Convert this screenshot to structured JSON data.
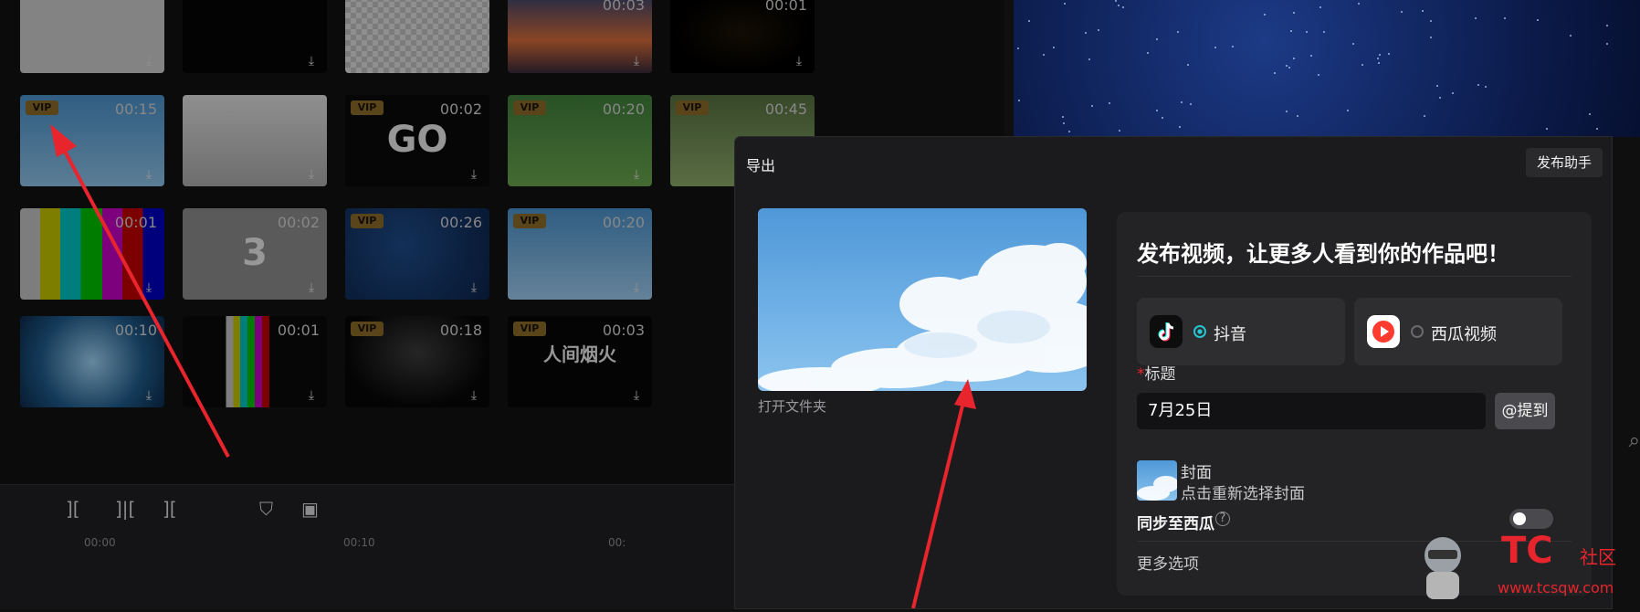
{
  "media_grid": {
    "rows": [
      [
        {
          "duration": "",
          "vip": false,
          "style": "grey"
        },
        {
          "duration": "",
          "vip": false,
          "style": "black"
        },
        {
          "duration": "",
          "vip": false,
          "style": "checker"
        },
        {
          "duration": "00:03",
          "vip": false,
          "style": "sunset"
        },
        {
          "duration": "00:01",
          "vip": false,
          "style": "ring"
        }
      ],
      [
        {
          "duration": "00:15",
          "vip": true,
          "vip_label": "VIP",
          "style": "sky"
        },
        {
          "duration": "",
          "vip": false,
          "style": "person"
        },
        {
          "duration": "00:02",
          "vip": true,
          "vip_label": "VIP",
          "style": "go",
          "text": "GO"
        },
        {
          "duration": "00:20",
          "vip": true,
          "vip_label": "VIP",
          "style": "forest"
        },
        {
          "duration": "00:45",
          "vip": true,
          "vip_label": "VIP",
          "style": "forest2"
        }
      ],
      [
        {
          "duration": "00:01",
          "vip": false,
          "style": "bars"
        },
        {
          "duration": "00:02",
          "vip": false,
          "style": "countdown",
          "text": "3"
        },
        {
          "duration": "00:26",
          "vip": true,
          "vip_label": "VIP",
          "style": "blue-dots"
        },
        {
          "duration": "00:20",
          "vip": true,
          "vip_label": "VIP",
          "style": "sky2"
        }
      ],
      [
        {
          "duration": "00:10",
          "vip": false,
          "style": "burst"
        },
        {
          "duration": "00:01",
          "vip": false,
          "style": "bars-vert"
        },
        {
          "duration": "00:18",
          "vip": true,
          "vip_label": "VIP",
          "style": "dark-glow"
        },
        {
          "duration": "00:03",
          "vip": true,
          "vip_label": "VIP",
          "style": "calligraphy",
          "text": "人间烟火"
        }
      ]
    ]
  },
  "timeline": {
    "ticks": [
      "00:00",
      "00:10",
      "00:"
    ]
  },
  "export_dialog": {
    "title": "导出",
    "publish_assistant": "发布助手",
    "open_folder": "打开文件夹",
    "headline": "发布视频，让更多人看到你的作品吧！",
    "platforms": [
      {
        "name": "抖音",
        "selected": true,
        "color": "#25f4ee"
      },
      {
        "name": "西瓜视频",
        "selected": false,
        "color": "#ff3b30"
      }
    ],
    "title_label": "标题",
    "title_required_mark": "*",
    "title_value": "7月25日",
    "mention_button": "@提到",
    "cover_label": "封面",
    "cover_hint": "点击重新选择封面",
    "sync_label": "同步至西瓜",
    "sync_enabled": false,
    "more_options": "更多选项"
  },
  "watermark": {
    "brand": "TC",
    "community": "社区",
    "url": "www.tcsqw.com"
  },
  "colors": {
    "accent_red": "#e8242c",
    "radio_selected": "#25c6d0",
    "vip_badge": "#8a6a2a"
  }
}
